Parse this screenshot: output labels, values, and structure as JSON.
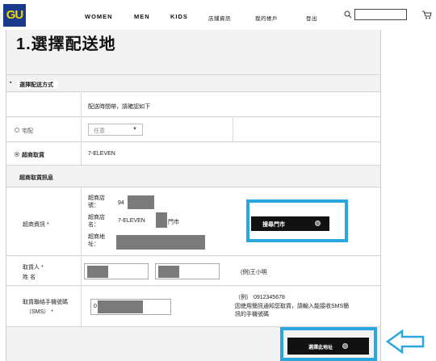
{
  "header": {
    "logo": "GU",
    "nav": [
      "WOMEN",
      "MEN",
      "KIDS",
      "店鋪資訊",
      "我的帳戶",
      "登出"
    ]
  },
  "page": {
    "title": "1.選擇配送地"
  },
  "delivery_method": {
    "heading": "選擇配送方式",
    "note": "配送時間帶，請確認如下",
    "home_label": "宅配",
    "home_select": "任意",
    "store_label": "超商取貨",
    "store_value": "7-ELEVEN"
  },
  "pickup_info": {
    "heading": "超商取貨訊息",
    "store_info_label": "超商資訊 *",
    "store_code_label": "超商店號：",
    "store_code_value": "94",
    "store_name_label": "超商店名：",
    "store_name_value": "7-ELEVEN",
    "store_name_suffix": "門市",
    "store_addr_label": "超商地址：",
    "search_store_button": "搜尋門市",
    "recipient_label_1": "取貨人 *",
    "recipient_label_2": "姓 名",
    "recipient_hint": "(例)王小明",
    "phone_label_1": "取貨聯絡手機號碼",
    "phone_label_2": "（SMS）  *",
    "phone_value": "0",
    "phone_hint_1": "（例） 0912345678",
    "phone_hint_2": "因使用簡訊通知您取貨，請輸入能接收SMS簡",
    "phone_hint_3": "訊的手機號碼",
    "select_address_button": "選擇此地址"
  },
  "colors": {
    "highlight": "#2aa7df",
    "logo_bg": "#1b3a8b",
    "logo_fg": "#f2d400",
    "button_bg": "#111111"
  },
  "icons": [
    "search-icon",
    "cart-icon",
    "arrow-left-icon"
  ]
}
